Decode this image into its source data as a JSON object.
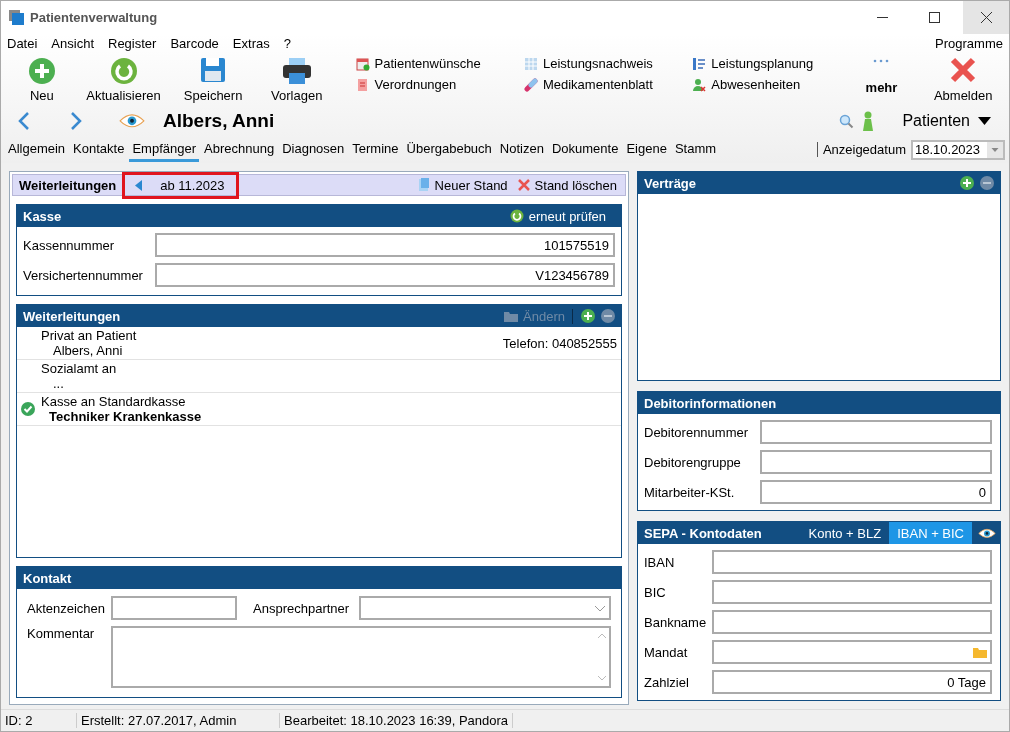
{
  "window": {
    "title": "Patientenverwaltung"
  },
  "menu": [
    "Datei",
    "Ansicht",
    "Register",
    "Barcode",
    "Extras",
    "?"
  ],
  "menu_right": "Programme",
  "toolbar": {
    "large": [
      {
        "label": "Neu",
        "kind": "new"
      },
      {
        "label": "Aktualisieren",
        "kind": "refresh"
      },
      {
        "label": "Speichern",
        "kind": "save"
      },
      {
        "label": "Vorlagen",
        "kind": "print"
      }
    ],
    "small_columns": [
      [
        {
          "label": "Patientenwünsche",
          "kind": "calendar"
        },
        {
          "label": "Verordnungen",
          "kind": "document"
        }
      ],
      [
        {
          "label": "Leistungsnachweis",
          "kind": "grid"
        },
        {
          "label": "Medikamentenblatt",
          "kind": "pill"
        }
      ],
      [
        {
          "label": "Leistungsplanung",
          "kind": "list"
        },
        {
          "label": "Abwesenheiten",
          "kind": "person"
        }
      ]
    ],
    "more": "mehr",
    "logout": "Abmelden"
  },
  "patient": {
    "name": "Albers, Anni",
    "module": "Patienten"
  },
  "tabs": [
    {
      "label": "Allgemein",
      "selected": false
    },
    {
      "label": "Kontakte",
      "selected": false
    },
    {
      "label": "Empfänger",
      "selected": true
    },
    {
      "label": "Abrechnung",
      "selected": false
    },
    {
      "label": "Diagnosen",
      "selected": false
    },
    {
      "label": "Termine",
      "selected": false
    },
    {
      "label": "Übergabebuch",
      "selected": false
    },
    {
      "label": "Notizen",
      "selected": false
    },
    {
      "label": "Dokumente",
      "selected": false
    },
    {
      "label": "Eigene",
      "selected": false
    },
    {
      "label": "Stamm",
      "selected": false
    }
  ],
  "display_date": {
    "label": "Anzeigedatum",
    "value": "18.10.2023"
  },
  "left": {
    "title": "Weiterleitungen",
    "version": "ab 11.2023",
    "new_version": "Neuer Stand",
    "delete_version": "Stand löschen",
    "kasse": {
      "title": "Kasse",
      "action": "erneut prüfen",
      "fields": [
        {
          "label": "Kassennummer",
          "value": "101575519"
        },
        {
          "label": "Versichertennummer",
          "value": "V123456789"
        }
      ]
    },
    "forwards": {
      "title": "Weiterleitungen",
      "edit": {
        "label": "Ändern",
        "disabled": true
      },
      "rows": [
        {
          "title": "Privat an Patient",
          "detail": "Albers, Anni",
          "extra": "Telefon: 040852555",
          "checked": false
        },
        {
          "title": "Sozialamt an",
          "detail": "...",
          "checked": false
        },
        {
          "title": "Kasse an Standardkasse",
          "detail": "Techniker Krankenkasse",
          "checked": true
        }
      ]
    },
    "contact": {
      "title": "Kontakt",
      "file_ref": "Aktenzeichen",
      "contact_person": "Ansprechpartner",
      "comment": "Kommentar"
    }
  },
  "right": {
    "contracts": {
      "title": "Verträge"
    },
    "debtor": {
      "title": "Debitorinformationen",
      "fields": [
        {
          "label": "Debitorennummer"
        },
        {
          "label": "Debitorengruppe"
        },
        {
          "label": "Mitarbeiter-KSt.",
          "value": "0"
        }
      ]
    },
    "sepa": {
      "title": "SEPA - Kontodaten",
      "modes": [
        {
          "label": "Konto + BLZ",
          "selected": false
        },
        {
          "label": "IBAN + BIC",
          "selected": true
        }
      ],
      "fields": [
        {
          "label": "IBAN",
          "kind": "text"
        },
        {
          "label": "BIC",
          "kind": "text"
        },
        {
          "label": "Bankname",
          "kind": "text"
        },
        {
          "label": "Mandat",
          "kind": "folder"
        },
        {
          "label": "Zahlziel",
          "kind": "text",
          "value": "0 Tage"
        }
      ]
    }
  },
  "status_bar": [
    "ID: 2",
    "Erstellt: 27.07.2017, Admin",
    "Bearbeitet: 18.10.2023 16:39, Pandora"
  ]
}
